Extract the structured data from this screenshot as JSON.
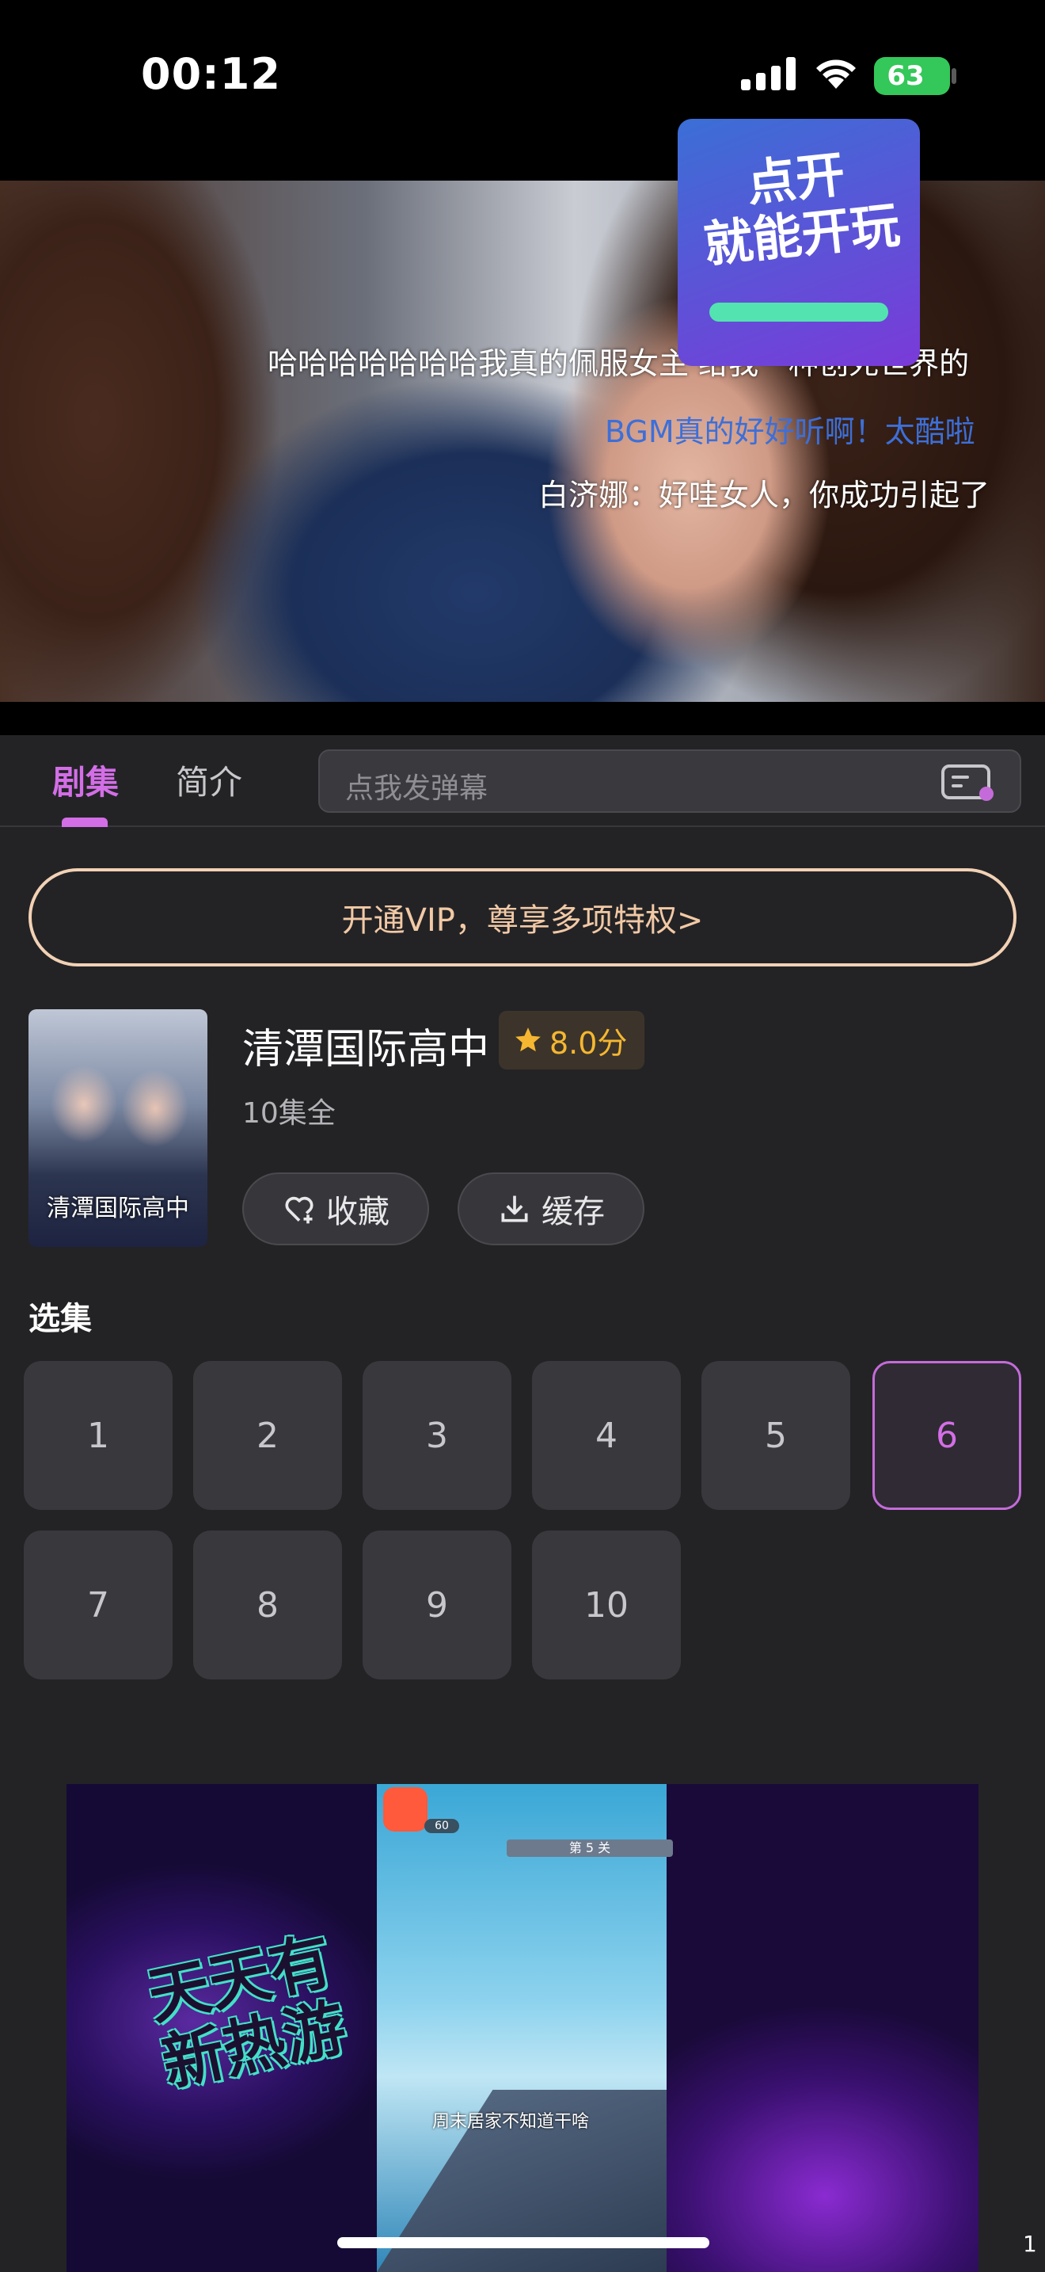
{
  "status_bar": {
    "time": "00:12",
    "battery": "63"
  },
  "video": {
    "danmaku": [
      "哈哈哈哈哈哈哈我真的佩服女主  给我一种创死世界的",
      "BGM真的好好听啊！太酷啦",
      "白济娜：好哇女人，你成功引起了"
    ]
  },
  "tabs": {
    "episodes": "剧集",
    "intro": "简介"
  },
  "danmaku_input": {
    "placeholder": "点我发弹幕"
  },
  "vip": {
    "label": "开通VIP，尊享多项特权>"
  },
  "show": {
    "poster_title": "清潭国际高中",
    "title": "清潭国际高中",
    "rating": "8.0分",
    "episodes_total": "10集全",
    "favorite_label": "收藏",
    "cache_label": "缓存"
  },
  "episode_section": {
    "title": "选集",
    "episodes": [
      "1",
      "2",
      "3",
      "4",
      "5",
      "6",
      "7",
      "8",
      "9",
      "10"
    ],
    "current": "6"
  },
  "ad": {
    "left_text_line1": "天天有",
    "left_text_line2": "新热游",
    "right_text_line1": "点开",
    "right_text_line2": "就能开玩",
    "level_text": "第 5 关",
    "score": "60",
    "caption": "周末居家不知道干啥"
  },
  "page_number": "1",
  "colors": {
    "accent": "#d36ee6",
    "vip": "#f2c9a5",
    "rating": "#f5b731",
    "background": "#232326"
  }
}
